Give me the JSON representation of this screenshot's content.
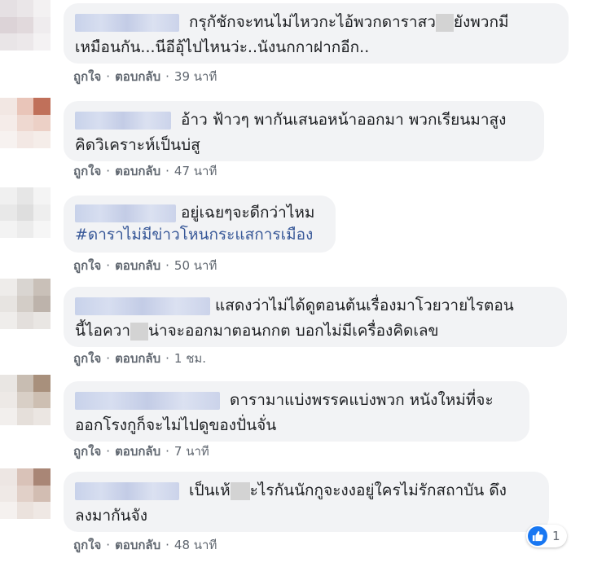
{
  "comments": [
    {
      "text": "กรุกัชักจะทนไม่ไหวกะไอ้พวกดาราสว",
      "text_b": "ยังพวกมี",
      "line2": "เหมือนกัน...นีอีอุ้ไปไหนว่ะ..นังนกกาฝากอีก..",
      "like": "ถูกใจ",
      "reply": "ตอบกลับ",
      "time": "39 นาที"
    },
    {
      "text": "อ้าว ฟ้าวๆ พากันเสนอหน้าออกมา พวกเรียนมาสูง",
      "line2": "คิดวิเคราะห์เป็นบ่สู",
      "like": "ถูกใจ",
      "reply": "ตอบกลับ",
      "time": "47 นาที"
    },
    {
      "text": "อยู่เฉยๆจะดีกว่าไหม",
      "hashtag": "#ดาราไม่มีข่าวโหนกระแสการเมือง",
      "like": "ถูกใจ",
      "reply": "ตอบกลับ",
      "time": "50 นาที"
    },
    {
      "text": "แสดงว่าไม่ได้ดูตอนต้นเรื่องมาโวยวายไรตอน",
      "line2a": "นี้ไอควา",
      "line2b": "น่าจะออกมาตอนกกต บอกไม่มีเครื่องคิดเลข",
      "like": "ถูกใจ",
      "reply": "ตอบกลับ",
      "time": "1 ชม."
    },
    {
      "text": "ดารามาแบ่งพรรคแบ่งพวก หนังใหม่ที่จะ",
      "line2": "ออกโรงกูก็จะไม่ไปดูของปั่นจั่น",
      "like": "ถูกใจ",
      "reply": "ตอบกลับ",
      "time": "7 นาที"
    },
    {
      "text": "เป็นเห้",
      "text_b": "ะไรกันนักกูจะงงอยู่ใครไม่รักสถาบัน ดึง",
      "line2": "ลงมากันจัง",
      "like": "ถูกใจ",
      "reply": "ตอบกลับ",
      "time": "48 นาที"
    }
  ],
  "reaction": {
    "count": "1",
    "icon": "like-icon"
  },
  "colors": {
    "bubble": "#f2f3f5",
    "link": "#606770",
    "hashtag": "#385898",
    "like_blue": "#1877f2"
  }
}
